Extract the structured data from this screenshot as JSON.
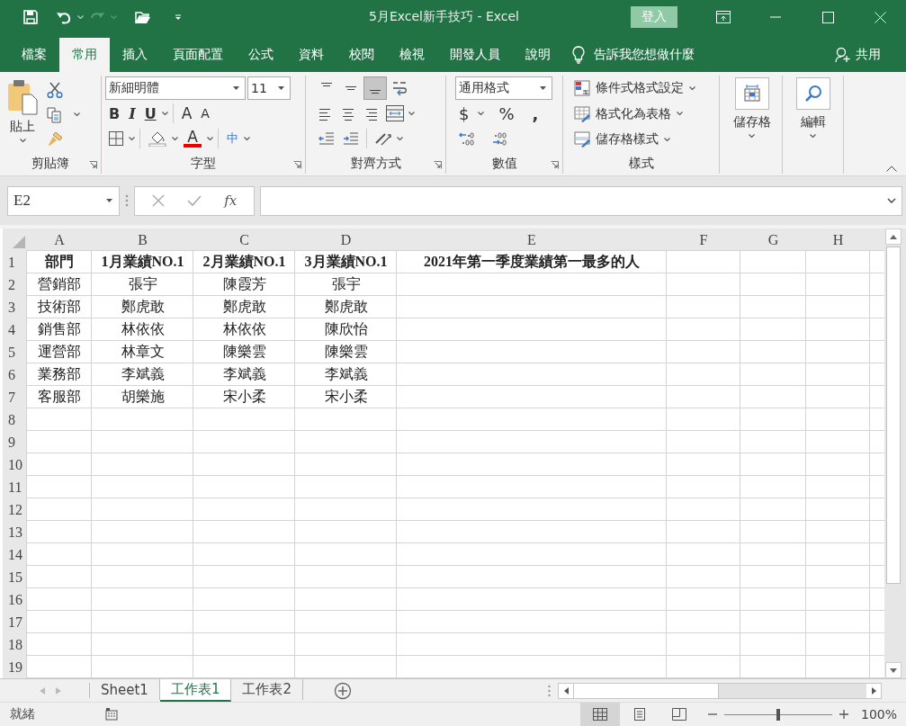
{
  "window": {
    "title": "5月Excel新手技巧 - Excel",
    "sign_in": "登入"
  },
  "tabs": [
    {
      "label": "檔案",
      "selected": false
    },
    {
      "label": "常用",
      "selected": true
    },
    {
      "label": "插入",
      "selected": false
    },
    {
      "label": "頁面配置",
      "selected": false
    },
    {
      "label": "公式",
      "selected": false
    },
    {
      "label": "資料",
      "selected": false
    },
    {
      "label": "校閱",
      "selected": false
    },
    {
      "label": "檢視",
      "selected": false
    },
    {
      "label": "開發人員",
      "selected": false
    },
    {
      "label": "說明",
      "selected": false
    }
  ],
  "tell_me": "告訴我您想做什麼",
  "share": "共用",
  "ribbon": {
    "clipboard": {
      "paste": "貼上",
      "label": "剪貼簿"
    },
    "font": {
      "name": "新細明體",
      "size": "11",
      "styles": [
        "B",
        "I",
        "U"
      ],
      "grow": "A",
      "shrink": "A",
      "color_letter": "A",
      "phonetic": "中",
      "label": "字型"
    },
    "alignment": {
      "vertical": [
        {
          "selected": false
        },
        {
          "selected": false
        },
        {
          "selected": true
        }
      ],
      "label": "對齊方式"
    },
    "number": {
      "format": "通用格式",
      "currency": "$",
      "percent": "%",
      "comma": ",",
      "label": "數值"
    },
    "styles": {
      "items": [
        "條件式格式設定",
        "格式化為表格",
        "儲存格樣式"
      ],
      "label": "樣式"
    },
    "cells": {
      "label": "儲存格"
    },
    "editing": {
      "label": "編輯"
    }
  },
  "formula_bar": {
    "name_box": "E2",
    "fx": "fx"
  },
  "sheet": {
    "columns": [
      "A",
      "B",
      "C",
      "D",
      "E",
      "F",
      "G",
      "H"
    ],
    "rows": [
      {
        "number": "1",
        "cells": [
          "部門",
          "1月業績NO.1",
          "2月業績NO.1",
          "3月業績NO.1",
          "2021年第一季度業績第一最多的人"
        ]
      },
      {
        "number": "2",
        "cells": [
          "營銷部",
          "張宇",
          "陳霞芳",
          "張宇"
        ]
      },
      {
        "number": "3",
        "cells": [
          "技術部",
          "鄭虎敢",
          "鄭虎敢",
          "鄭虎敢"
        ]
      },
      {
        "number": "4",
        "cells": [
          "銷售部",
          "林依依",
          "林依依",
          "陳欣怡"
        ]
      },
      {
        "number": "5",
        "cells": [
          "運營部",
          "林章文",
          "陳樂雲",
          "陳樂雲"
        ]
      },
      {
        "number": "6",
        "cells": [
          "業務部",
          "李斌義",
          "李斌義",
          "李斌義"
        ]
      },
      {
        "number": "7",
        "cells": [
          "客服部",
          "胡樂施",
          "宋小柔",
          "宋小柔"
        ]
      },
      {
        "number": "8"
      },
      {
        "number": "9"
      },
      {
        "number": "10"
      },
      {
        "number": "11"
      },
      {
        "number": "12"
      },
      {
        "number": "13"
      },
      {
        "number": "14"
      },
      {
        "number": "15"
      },
      {
        "number": "16"
      },
      {
        "number": "17"
      },
      {
        "number": "18"
      },
      {
        "number": "19"
      }
    ]
  },
  "sheet_tabs": [
    {
      "label": "Sheet1",
      "selected": false
    },
    {
      "label": "工作表1",
      "selected": true
    },
    {
      "label": "工作表2",
      "selected": false
    }
  ],
  "status_bar": {
    "status": "就緒",
    "views": [
      {
        "selected": true
      },
      {
        "selected": false
      },
      {
        "selected": false
      }
    ],
    "zoom": "100%",
    "zoom_slider": {
      "level": 0.5
    }
  }
}
